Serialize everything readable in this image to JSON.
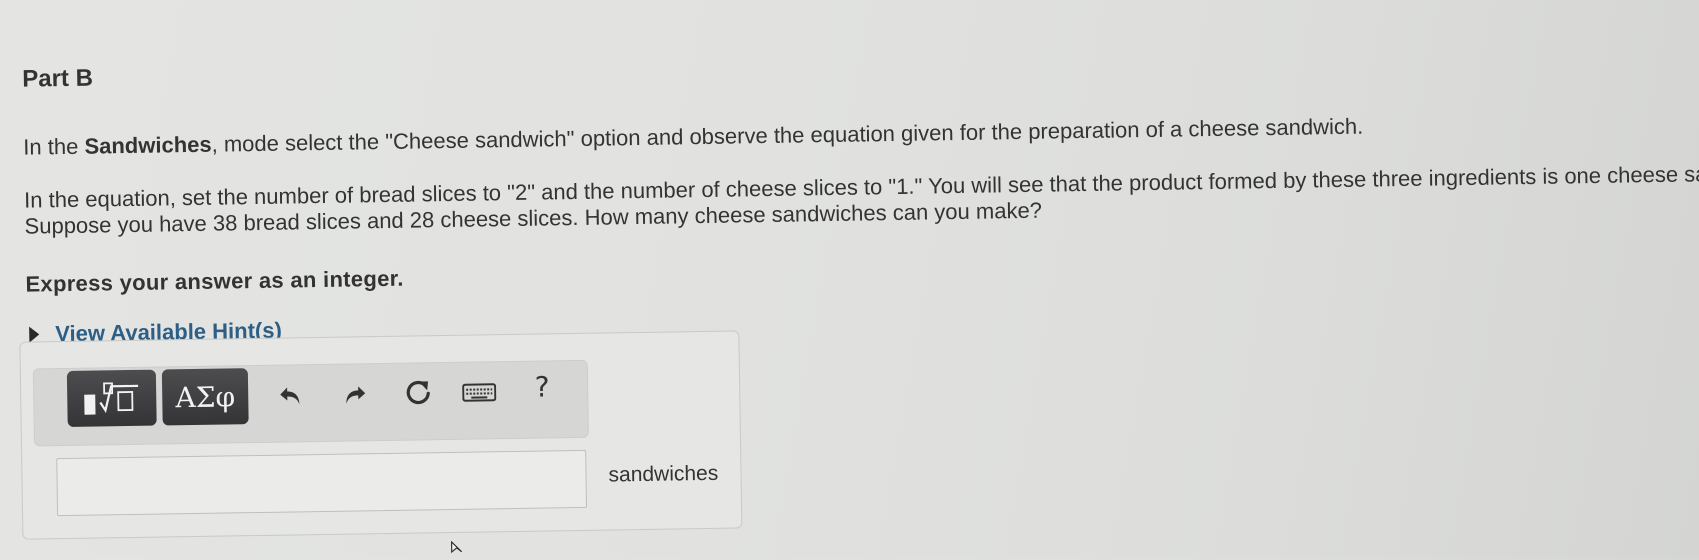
{
  "part": {
    "title": "Part B"
  },
  "question": {
    "p1_pre": "In the ",
    "p1_bold": "Sandwiches",
    "p1_post": ", mode select the \"Cheese sandwich\" option and observe the equation given for the preparation of a cheese sandwich.",
    "p2": "In the equation, set the number of bread slices to \"2\" and the number of cheese slices to \"1.\" You will see that the product formed by these three ingredients is one cheese san",
    "p3": "Suppose you have 38 bread slices and 28 cheese slices. How many cheese sandwiches can you make?",
    "instruction": "Express your answer as an integer."
  },
  "hints": {
    "label": "View Available Hint(s)"
  },
  "toolbar": {
    "templates_label": "√",
    "symbols_label": "ΑΣφ",
    "help_label": "?",
    "icons": [
      "templates-icon",
      "undo-icon",
      "redo-icon",
      "reset-icon",
      "keyboard-icon",
      "help-icon"
    ]
  },
  "answer": {
    "value": "",
    "unit": "sandwiches"
  },
  "colors": {
    "hint_link": "#2d5f86",
    "button_dark": "#3d3d3f",
    "background": "#e2e3e1"
  }
}
